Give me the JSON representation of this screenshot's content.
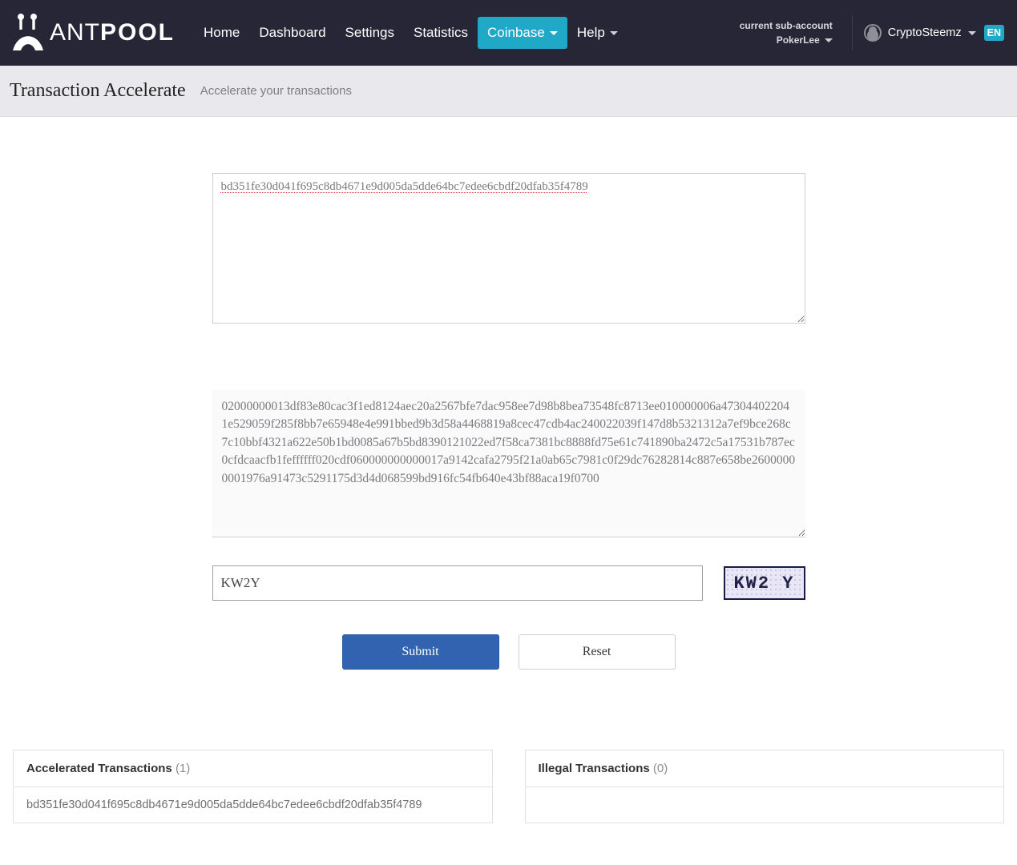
{
  "header": {
    "logo_text_light": "ANT",
    "logo_text_bold": "POOL",
    "nav": {
      "home": "Home",
      "dashboard": "Dashboard",
      "settings": "Settings",
      "statistics": "Statistics",
      "coinbase": "Coinbase",
      "help": "Help"
    },
    "sub_account_label": "current sub-account",
    "sub_account_value": "PokerLee",
    "username": "CryptoSteemz",
    "lang": "EN"
  },
  "subheader": {
    "title": "Transaction Accelerate",
    "desc": "Accelerate your transactions"
  },
  "form": {
    "txid_value": "bd351fe30d041f695c8db4671e9d005da5dde64bc7edee6cbdf20dfab35f4789",
    "raw_value": "02000000013df83e80cac3f1ed8124aec20a2567bfe7dac958ee7d98b8bea73548fc8713ee010000006a473044022041e529059f285f8bb7e65948e4e991bbed9b3d58a4468819a8cec47cdb4ac240022039f147d8b5321312a7ef9bce268c7c10bbf4321a622e50b1bd0085a67b5bd8390121022ed7f58ca7381bc8888fd75e61c741890ba2472c5a17531b787ec0cfdcaacfb1feffffff020cdf060000000000017a9142cafa2795f21a0ab65c7981c0f29dc76282814c887e658be26000000001976a91473c5291175d3d4d068599bd916fc54fb640e43bf88aca19f0700",
    "captcha_value": "KW2Y",
    "captcha_image_text": "KW2 Y",
    "submit_label": "Submit",
    "reset_label": "Reset"
  },
  "panels": {
    "accelerated": {
      "title": "Accelerated Transactions",
      "count": "(1)",
      "rows": [
        "bd351fe30d041f695c8db4671e9d005da5dde64bc7edee6cbdf20dfab35f4789"
      ]
    },
    "illegal": {
      "title": "Illegal Transactions",
      "count": "(0)"
    }
  }
}
